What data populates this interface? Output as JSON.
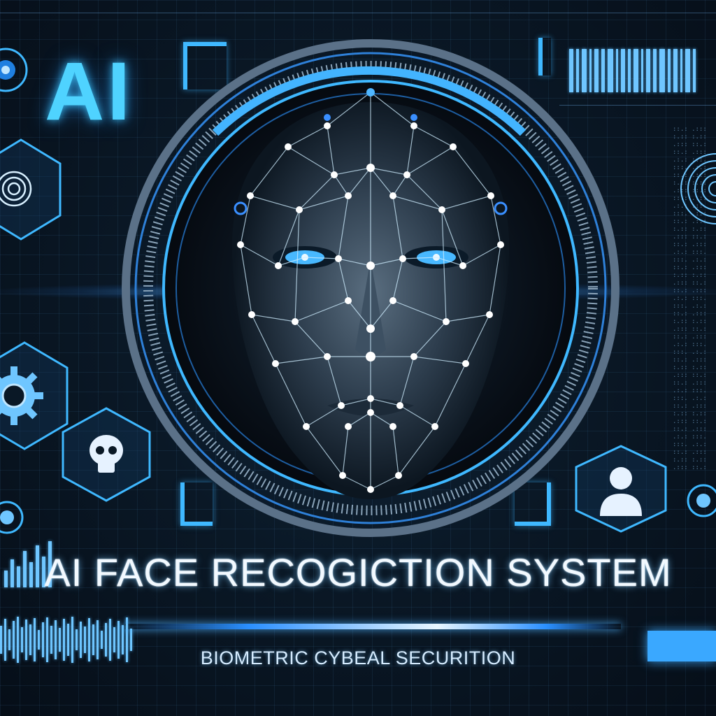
{
  "logo_text": "AI",
  "title": "AI FACE RECOGICTION SYSTEM",
  "subtitle": "BIOMETRIC CYBEAL SECURITION",
  "colors": {
    "accent": "#3fb8ff",
    "glow": "#4fd3ff",
    "background": "#0a1826",
    "title_text": "#f2f9ff"
  },
  "icons": [
    "fingerprint-icon",
    "gear-icon",
    "skull-icon",
    "user-profile-icon",
    "face-scan-icon"
  ]
}
